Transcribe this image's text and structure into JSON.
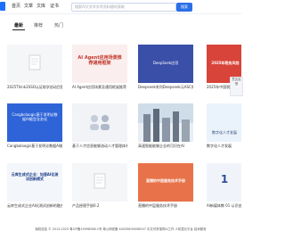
{
  "nav": {
    "links": [
      "首页",
      "文章",
      "文库",
      "证书"
    ]
  },
  "search": {
    "placeholder": "搜索AI大学术学术资料随时获取",
    "button": "搜索"
  },
  "tabs": [
    "最新",
    "推荐",
    "热门"
  ],
  "cards": [
    {
      "caption": "2025Think2SSO认证助学创动目管理和中AI创新科技",
      "thumb_text": "",
      "icon": "document-icon"
    },
    {
      "caption": "AI Agent应用场景及通用框架推荐",
      "thumb_text": "AI Agent应用场景推荐通用框架",
      "icon": ""
    },
    {
      "caption": "Deepseek系列Deepseek元ASC实用",
      "thumb_text": "DeepSeek应用",
      "icon": ""
    },
    {
      "caption": "2025年中国税务风险管控",
      "thumb_text": "2025年税务风险",
      "icon": ""
    },
    {
      "caption": "Cangbolaogic基于发明诊数据AI能型业务化",
      "thumb_text": "Cangbolaogic基于发明诊数据AI能型业务化",
      "icon": ""
    },
    {
      "caption": "基于人才信息能够流动人才管理体系实践建",
      "thumb_text": "",
      "icon": "people-icon"
    },
    {
      "caption": "高速智能能够企业的可识在AI",
      "thumb_text": "",
      "icon": ""
    },
    {
      "caption": "数字化人才发展",
      "thumb_text": "数字化人才发展",
      "icon": ""
    },
    {
      "caption": "云库生成式企业AI化测试创新的融合",
      "thumb_text": "云库生成式企业：加速AI化测试创新模式",
      "icon": ""
    },
    {
      "caption": "产品经理手册0.2",
      "thumb_text": "",
      "icon": "document-icon"
    },
    {
      "caption": "直播的中层服务技术手册",
      "thumb_text": "直播的中层服务技术手册",
      "icon": ""
    },
    {
      "caption": "AI新媒体教 01 认识创新AI+应用的",
      "thumb_text": "1",
      "icon": ""
    }
  ],
  "feedback": "意见反馈",
  "footer": "版权信息 © 2013-2025 粤ICP备19098586-1号 粤公网安备 4403060900B547 中文可享指导AI工作 人机混元平台 技术服务"
}
